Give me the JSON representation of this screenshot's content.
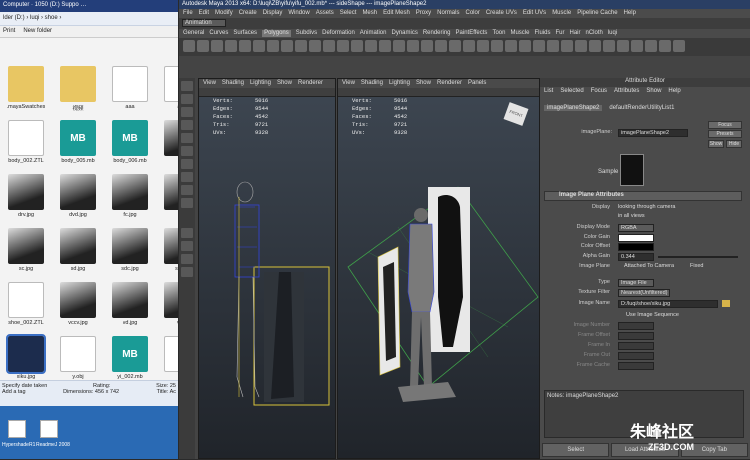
{
  "explorer": {
    "top_title": "Computer · 1050   (D:)   Suppo   …",
    "address": "lder (D:) › luqi › shoe ›",
    "toolbar": [
      "Print",
      "New folder"
    ],
    "files": [
      {
        "name": ".mayaSwatches",
        "kind": "folder"
      },
      {
        "name": "视频",
        "kind": "folder"
      },
      {
        "name": "aaa",
        "kind": "doc"
      },
      {
        "name": "aaa",
        "kind": "doc"
      },
      {
        "name": "body_002.ZTL",
        "kind": "doc"
      },
      {
        "name": "body_005.mb",
        "kind": "mb"
      },
      {
        "name": "body_006.mb",
        "kind": "mb"
      },
      {
        "name": "d.jp",
        "kind": "photo"
      },
      {
        "name": "drv.jpg",
        "kind": "photo"
      },
      {
        "name": "dvd.jpg",
        "kind": "photo"
      },
      {
        "name": "fc.jpg",
        "kind": "photo"
      },
      {
        "name": "fds.",
        "kind": "photo"
      },
      {
        "name": "sc.jpg",
        "kind": "photo"
      },
      {
        "name": "sd.jpg",
        "kind": "photo"
      },
      {
        "name": "sdc.jpg",
        "kind": "photo"
      },
      {
        "name": "sdf (2",
        "kind": "photo"
      },
      {
        "name": "shoe_002.ZTL",
        "kind": "doc"
      },
      {
        "name": "vccv.jpg",
        "kind": "photo"
      },
      {
        "name": "vd.jpg",
        "kind": "photo"
      },
      {
        "name": "vex.",
        "kind": "photo"
      },
      {
        "name": "xiku.jpg",
        "kind": "photo-sel"
      },
      {
        "name": "y.obj",
        "kind": "doc"
      },
      {
        "name": "yi_002.mb",
        "kind": "mb"
      },
      {
        "name": "",
        "kind": "doc"
      }
    ],
    "status": {
      "line1a": "Specify date taken",
      "line1b": "Rating:",
      "line1c": "Size: 25",
      "line2a": "Add a tag",
      "line2b": "Dimensions: 456 x 742",
      "line2c": "Title: Ac"
    },
    "taskbar_labels": [
      "HypershadeR1",
      "ReadmeJ 2008"
    ]
  },
  "maya": {
    "title": "Autodesk Maya 2013 x64: D:\\luqi\\ZB\\yifu\\yifu_002.mb*   ---   sideShape --- imagePlaneShape2",
    "menu": [
      "File",
      "Edit",
      "Modify",
      "Create",
      "Display",
      "Window",
      "Assets",
      "Select",
      "Mesh",
      "Edit Mesh",
      "Proxy",
      "Normals",
      "Color",
      "Create UVs",
      "Edit UVs",
      "Muscle",
      "Pipeline Cache",
      "Help"
    ],
    "mode": "Animation",
    "shelf_tabs": [
      "General",
      "Curves",
      "Surfaces",
      "Polygons",
      "Subdivs",
      "Deformation",
      "Animation",
      "Dynamics",
      "Rendering",
      "PaintEffects",
      "Toon",
      "Muscle",
      "Fluids",
      "Fur",
      "Hair",
      "nCloth",
      "luqi"
    ],
    "active_shelf": "Polygons",
    "viewport_menu": [
      "View",
      "Shading",
      "Lighting",
      "Show",
      "Renderer",
      "Panels"
    ],
    "hud": [
      {
        "k": "Verts:",
        "v": "5016"
      },
      {
        "k": "Edges:",
        "v": "9544"
      },
      {
        "k": "Faces:",
        "v": "4542"
      },
      {
        "k": "Tris:",
        "v": "9721"
      },
      {
        "k": "UVs:",
        "v": "9328"
      }
    ],
    "cube_label": "FRONT"
  },
  "ae": {
    "title": "Attribute Editor",
    "menu": [
      "List",
      "Selected",
      "Focus",
      "Attributes",
      "Show",
      "Help"
    ],
    "tabs": [
      "imagePlaneShape2",
      "defaultRenderUtilityList1"
    ],
    "name_label": "imagePlane:",
    "name_value": "imagePlaneShape2",
    "focus": "Focus",
    "presets": "Presets",
    "show": "Show",
    "hide": "Hide",
    "sample": "Sample",
    "section": "Image Plane Attributes",
    "display_label": "Display",
    "display_opt1": "looking through camera",
    "display_opt2": "in all views",
    "display_mode_label": "Display Mode",
    "display_mode": "RGBA",
    "color_gain": "Color Gain",
    "color_offset": "Color Offset",
    "alpha_gain_label": "Alpha Gain",
    "alpha_gain": "0.344",
    "image_plane_label": "Image Plane",
    "attached": "Attached To Camera",
    "fixed": "Fixed",
    "type_label": "Type",
    "type": "Image File",
    "tex_filter_label": "Texture Filter",
    "tex_filter": "Nearest(Unfiltered)",
    "image_name_label": "Image Name",
    "image_name": "D:/luqi/shoe/xiku.jpg",
    "use_seq": "Use Image Sequence",
    "image_number": "Image Number",
    "frame_offset": "Frame Offset",
    "frame_in": "Frame In",
    "frame_out": "Frame Out",
    "frame_cache": "Frame Cache",
    "notes": "Notes: imagePlaneShape2",
    "bottom": [
      "Select",
      "Load Attributes",
      "Copy Tab"
    ]
  },
  "watermark": {
    "cn": "朱峰社区",
    "url": "ZF3D.COM"
  }
}
